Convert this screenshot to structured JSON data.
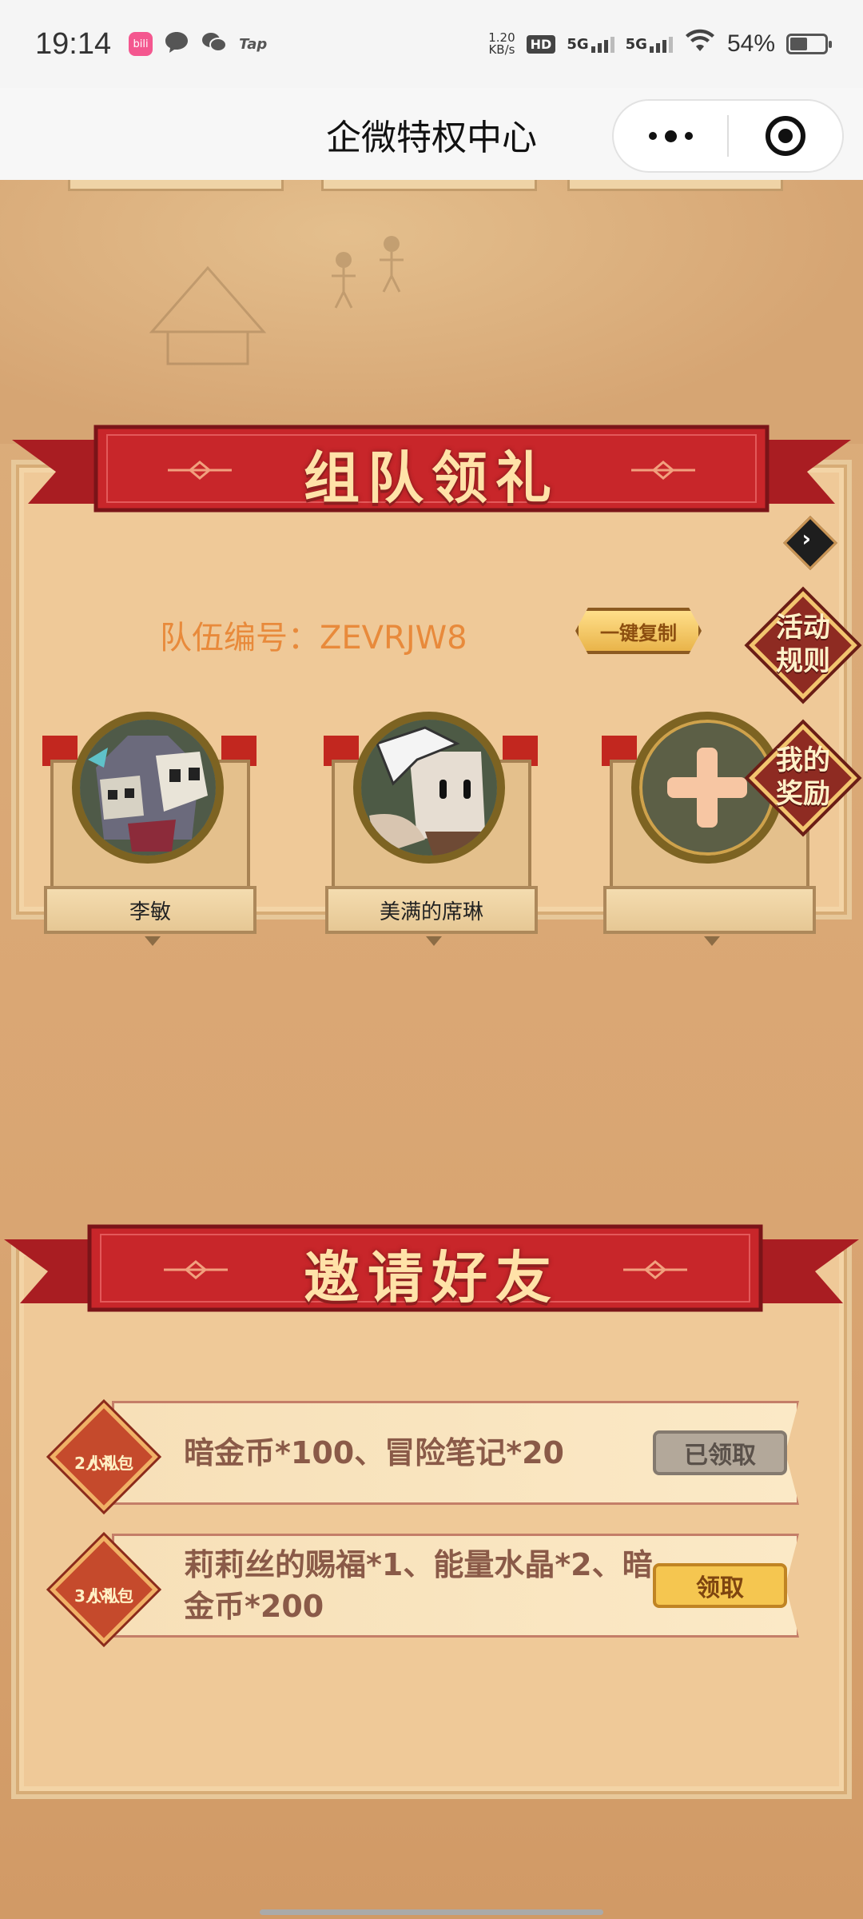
{
  "status_bar": {
    "time": "19:14",
    "net_speed_value": "1.20",
    "net_speed_unit": "KB/s",
    "hd_label": "HD",
    "sim1_label": "5G",
    "sim2_label": "5G",
    "battery_percent": "54%",
    "tap_label": "Tap",
    "bili_label": "bili"
  },
  "nav": {
    "title": "企微特权中心"
  },
  "team_section": {
    "title": "组队领礼",
    "team_code_label": "队伍编号：",
    "team_code": "ZEVRJW8",
    "copy_button": "一键复制",
    "rules_button": "活动规则",
    "reward_button": "我的奖励",
    "members": [
      {
        "name": "李敏"
      },
      {
        "name": "美满的席琳"
      },
      {
        "name": ""
      }
    ]
  },
  "invite_section": {
    "title": "邀请好友",
    "gifts": [
      {
        "badge": "小队2人礼包",
        "badge_line1": "小队",
        "badge_line2": "2人礼包",
        "reward": "暗金币*100、冒险笔记*20",
        "button": "已领取",
        "status": "claimed"
      },
      {
        "badge": "小队3人礼包",
        "badge_line1": "小队",
        "badge_line2": "3人礼包",
        "reward": "莉莉丝的赐福*1、能量水晶*2、暗金币*200",
        "button": "领取",
        "status": "available"
      }
    ]
  },
  "colors": {
    "ribbon_red": "#c8262a",
    "title_gold": "#ffe2a8",
    "team_code_orange": "#e88a3b",
    "claim_yellow": "#f5c650",
    "claimed_gray": "#b3a89a"
  }
}
